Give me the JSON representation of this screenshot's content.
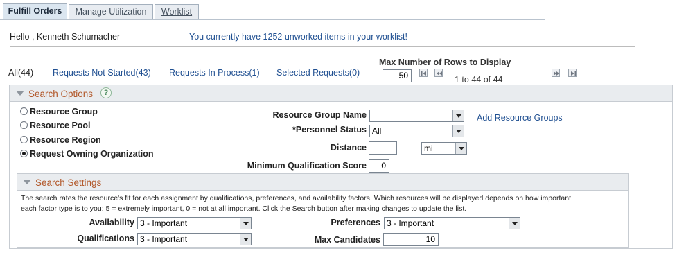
{
  "tabs": [
    {
      "label": "Fulfill Orders"
    },
    {
      "label": "Manage Utilization"
    },
    {
      "label": "Worklist"
    }
  ],
  "greeting": "Hello , Kenneth Schumacher",
  "worklist_message": "You currently have 1252 unworked items in your worklist!",
  "filters": {
    "all": "All(44)",
    "not_started": "Requests Not Started(43)",
    "in_process": "Requests In Process(1)",
    "selected": "Selected Requests(0)"
  },
  "pagination": {
    "max_rows_label": "Max Number of Rows to Display",
    "max_rows_value": "50",
    "range_text": "1 to 44 of 44"
  },
  "search_options": {
    "title": "Search Options",
    "help_icon": "?",
    "radios": [
      {
        "label": "Resource Group",
        "checked": false
      },
      {
        "label": "Resource Pool",
        "checked": false
      },
      {
        "label": "Resource Region",
        "checked": false
      },
      {
        "label": "Request Owning Organization",
        "checked": true
      }
    ],
    "resource_group_name_label": "Resource Group Name",
    "resource_group_name_value": "",
    "add_resource_groups_link": "Add Resource Groups",
    "personnel_status_label": "*Personnel Status",
    "personnel_status_value": "All",
    "distance_label": "Distance",
    "distance_value": "",
    "distance_unit": "mi",
    "min_qual_score_label": "Minimum Qualification Score",
    "min_qual_score_value": "0"
  },
  "search_settings": {
    "title": "Search Settings",
    "description_line1": "The search rates the resource's fit for each assignment by qualifications, preferences, and availability factors. Which resources will be displayed depends on how important",
    "description_line2": "each factor type is to you: 5 = extremely important, 0 = not at all important. Click the Search button after making changes to update the list.",
    "availability_label": "Availability",
    "availability_value": "3 - Important",
    "preferences_label": "Preferences",
    "preferences_value": "3 - Important",
    "qualifications_label": "Qualifications",
    "qualifications_value": "3 - Important",
    "max_candidates_label": "Max Candidates",
    "max_candidates_value": "10"
  },
  "colors": {
    "link": "#1f4f91",
    "section_title": "#b2582a",
    "panel_header": "#e9ecef"
  }
}
